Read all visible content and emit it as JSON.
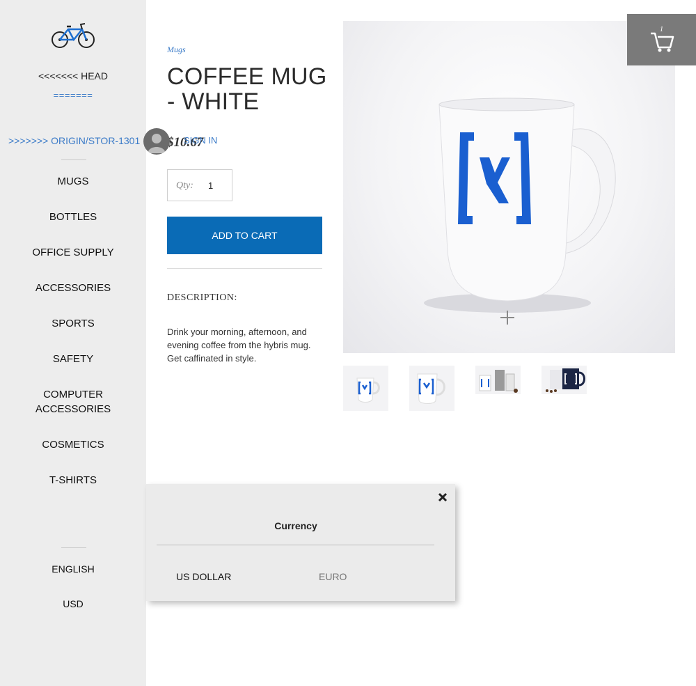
{
  "sidebar": {
    "merge_head": "<<<<<<< HEAD",
    "merge_separator": "=======",
    "merge_origin": ">>>>>>> ORIGIN/STOR-1301",
    "nav_items": [
      {
        "label": "MUGS"
      },
      {
        "label": "BOTTLES"
      },
      {
        "label": "OFFICE SUPPLY"
      },
      {
        "label": "ACCESSORIES"
      },
      {
        "label": "SPORTS"
      },
      {
        "label": "SAFETY"
      },
      {
        "label": "COMPUTER ACCESSORIES"
      },
      {
        "label": "COSMETICS"
      },
      {
        "label": "T-SHIRTS"
      }
    ],
    "language": "ENGLISH",
    "currency": "USD"
  },
  "product": {
    "category": "Mugs",
    "title": "COFFEE MUG - WHITE",
    "price": "$10.67",
    "qty_label": "Qty:",
    "qty_value": "1",
    "add_to_cart": "ADD TO CART",
    "description_heading": "DESCRIPTION:",
    "description": "Drink your morning, afternoon, and evening coffee from the hybris mug. Get caffinated in style."
  },
  "account": {
    "sign_in": "SIGN IN"
  },
  "cart": {
    "count": "1",
    "icon": "cart-icon"
  },
  "currency_popup": {
    "title": "Currency",
    "options": [
      {
        "label": "US DOLLAR",
        "selected": true
      },
      {
        "label": "EURO",
        "selected": false
      }
    ]
  },
  "icons": {
    "logo": "bicycle-logo-icon",
    "avatar": "user-avatar-icon",
    "zoom": "plus-zoom-icon",
    "close": "close-icon"
  },
  "colors": {
    "accent": "#0a6bb6",
    "link": "#3b7bc8",
    "sidebar_bg": "#ededed",
    "cart_bg": "#7a7a7a",
    "mug_logo": "#1a5fd0"
  }
}
